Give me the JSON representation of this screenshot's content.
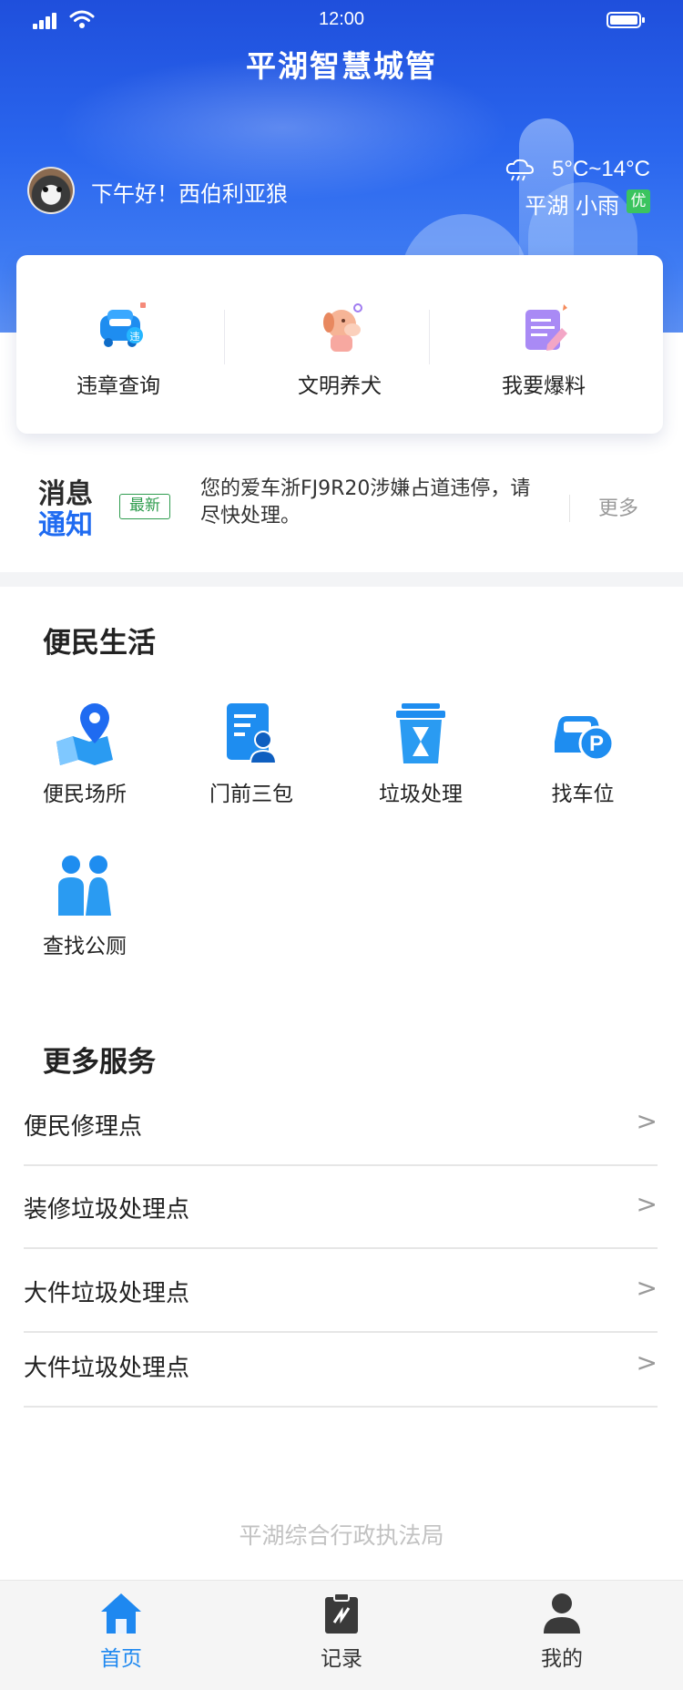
{
  "status_bar": {
    "time": "12:00"
  },
  "header": {
    "title": "平湖智慧城管",
    "greeting": "下午好！西伯利亚狼",
    "weather": {
      "temp": "5°C~14°C",
      "location_condition": "平湖 小雨",
      "aqi": "优",
      "icon": "cloud-rain-icon"
    }
  },
  "quick_actions": [
    {
      "label": "违章查询",
      "icon": "car-violation-icon"
    },
    {
      "label": "文明养犬",
      "icon": "dog-icon"
    },
    {
      "label": "我要爆料",
      "icon": "report-icon"
    }
  ],
  "notice": {
    "title_line1": "消息",
    "title_line2": "通知",
    "badge": "最新",
    "message": "您的爱车浙FJ9R20涉嫌占道违停，请尽快处理。",
    "more": "更多"
  },
  "convenience": {
    "title": "便民生活",
    "items": [
      {
        "label": "便民场所",
        "icon": "map-pin-icon"
      },
      {
        "label": "门前三包",
        "icon": "document-person-icon"
      },
      {
        "label": "垃圾处理",
        "icon": "trash-bin-icon"
      },
      {
        "label": "找车位",
        "icon": "parking-car-icon"
      },
      {
        "label": "查找公厕",
        "icon": "toilet-people-icon"
      }
    ]
  },
  "more_services": {
    "title": "更多服务",
    "items": [
      {
        "label": "便民修理点",
        "arrow": ">"
      },
      {
        "label": "装修垃圾处理点",
        "arrow": ">"
      },
      {
        "label": "大件垃圾处理点",
        "arrow": ">"
      },
      {
        "label": "大件垃圾处理点",
        "arrow": ">"
      }
    ]
  },
  "footer": "平湖综合行政执法局",
  "tabbar": [
    {
      "label": "首页",
      "icon": "home-icon",
      "active": true
    },
    {
      "label": "记录",
      "icon": "records-icon",
      "active": false
    },
    {
      "label": "我的",
      "icon": "user-icon",
      "active": false
    }
  ],
  "colors": {
    "primary": "#1f6bf1",
    "tab_active": "#1e88f0",
    "aqi_good": "#3bc45f",
    "badge_green": "#2e9c4e"
  }
}
